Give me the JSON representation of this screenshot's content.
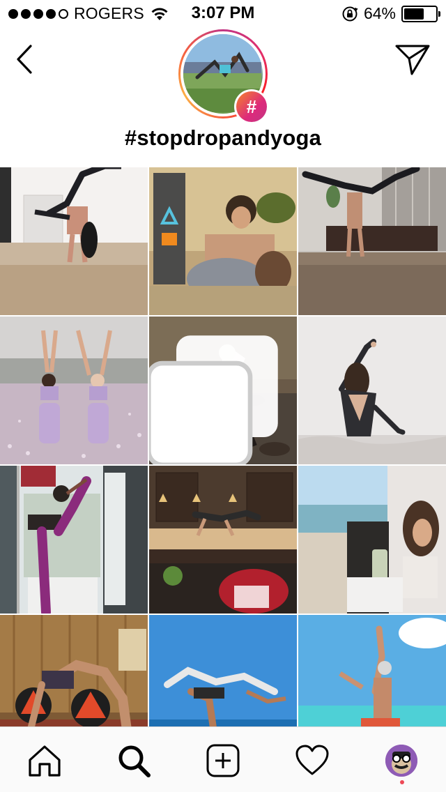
{
  "status_bar": {
    "carrier": "ROGERS",
    "time": "3:07 PM",
    "battery_percent_text": "64%",
    "battery_level": 0.64,
    "signal_dots_filled": 4,
    "signal_dots_total": 5
  },
  "header": {
    "hashtag": "#stopdropandyoga",
    "badge_symbol": "#"
  },
  "icons": {
    "back": "chevron-left-icon",
    "share": "paper-plane-icon",
    "home": "home-icon",
    "search": "search-icon",
    "new_post": "plus-square-icon",
    "activity": "heart-icon",
    "profile": "profile-avatar"
  },
  "grid": {
    "posts": [
      {
        "desc": "handstand pose, living room",
        "multi": false
      },
      {
        "desc": "couple portrait",
        "multi": false
      },
      {
        "desc": "handstand in mirrored room",
        "multi": false
      },
      {
        "desc": "two women in field, arms raised",
        "multi": false
      },
      {
        "desc": "acro yoga on rocky beach",
        "multi": true
      },
      {
        "desc": "backless top side stretch",
        "multi": false
      },
      {
        "desc": "dancer pose by window",
        "multi": false
      },
      {
        "desc": "crow pose on kitchen counter",
        "multi": false
      },
      {
        "desc": "woman at balcony with drink",
        "multi": false
      },
      {
        "desc": "wheel pose in front of drum kit",
        "multi": false
      },
      {
        "desc": "partner acro by the sea",
        "multi": false
      },
      {
        "desc": "man pose on beach",
        "multi": false
      }
    ]
  },
  "colors": {
    "accent_gradient_start": "#f58529",
    "accent_gradient_end": "#c13584",
    "notification": "#ed4956"
  }
}
